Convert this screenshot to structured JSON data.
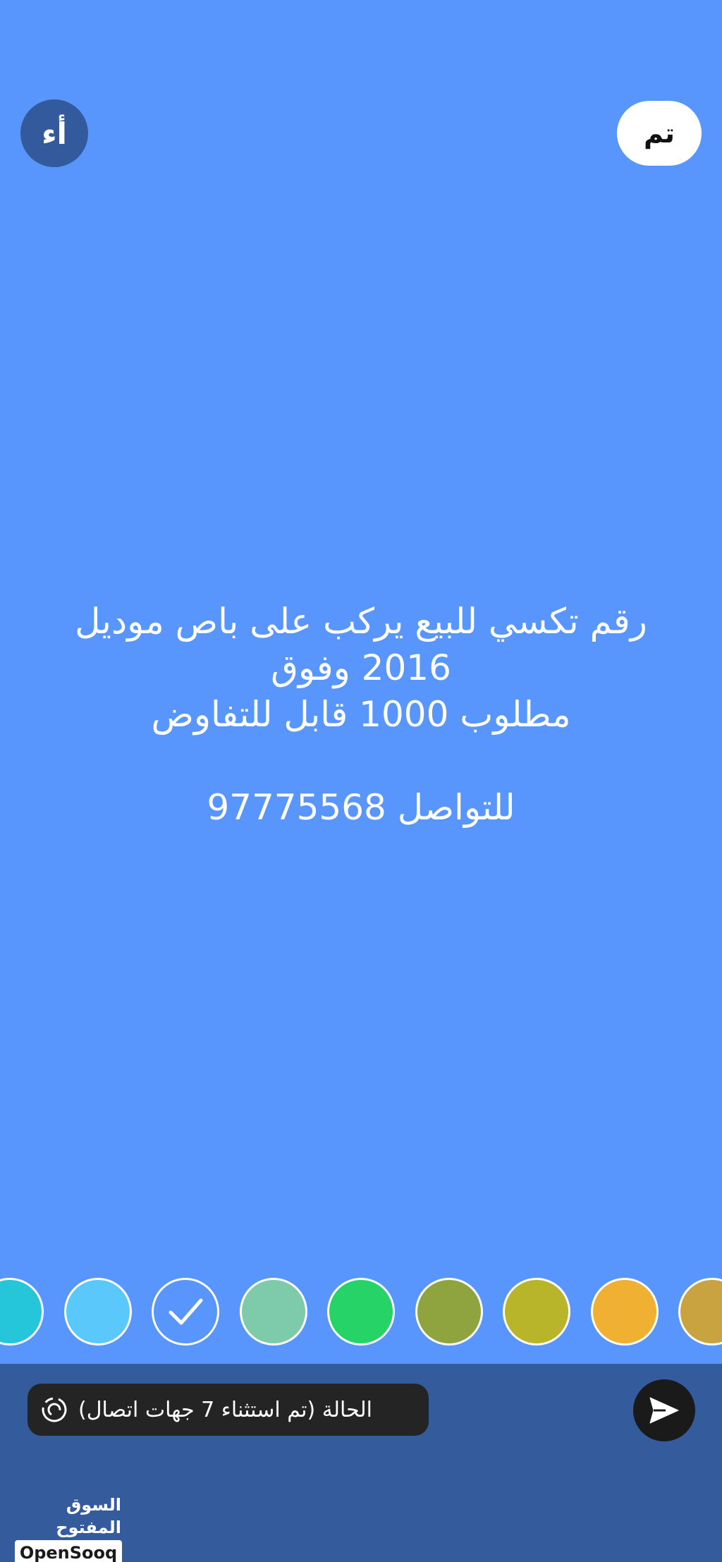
{
  "toolbar": {
    "font_button_label": "أء",
    "done_button_label": "تم"
  },
  "status": {
    "lines": [
      "رقم تكسي للبيع يركب على باص موديل",
      "2016 وفوق",
      "مطلوب 1000 قابل للتفاوض",
      "",
      "للتواصل 97775568"
    ],
    "background_color": "#5895fc"
  },
  "palette": {
    "swatches": [
      {
        "color": "#26c6da",
        "selected": false
      },
      {
        "color": "#5ac8fa",
        "selected": false
      },
      {
        "color": "#5895fc",
        "selected": true
      },
      {
        "color": "#7ecbab",
        "selected": false
      },
      {
        "color": "#25d366",
        "selected": false
      },
      {
        "color": "#8fa43f",
        "selected": false
      },
      {
        "color": "#b8b52a",
        "selected": false
      },
      {
        "color": "#f0b132",
        "selected": false
      },
      {
        "color": "#c8a340",
        "selected": false
      }
    ]
  },
  "bottom": {
    "audience_label": "الحالة (تم استثناء 7 جهات اتصال)",
    "audience_icon": "status-ring-icon",
    "send_icon": "send-icon"
  },
  "watermark": {
    "arabic": "السوق المفتوح",
    "english": "OpenSooq"
  }
}
